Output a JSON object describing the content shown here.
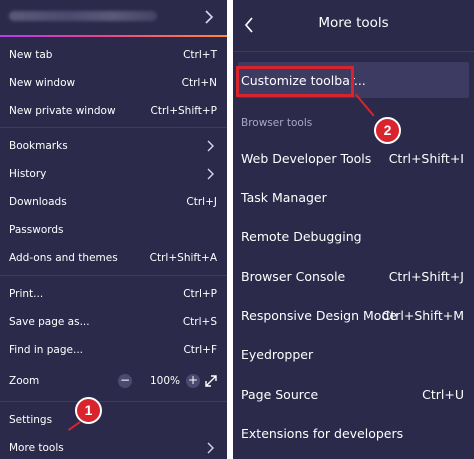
{
  "left_menu": {
    "items": [
      {
        "label": "New tab",
        "shortcut": "Ctrl+T"
      },
      {
        "label": "New window",
        "shortcut": "Ctrl+N"
      },
      {
        "label": "New private window",
        "shortcut": "Ctrl+Shift+P"
      },
      {
        "label": "Bookmarks",
        "shortcut": ""
      },
      {
        "label": "History",
        "shortcut": ""
      },
      {
        "label": "Downloads",
        "shortcut": "Ctrl+J"
      },
      {
        "label": "Passwords",
        "shortcut": ""
      },
      {
        "label": "Add-ons and themes",
        "shortcut": "Ctrl+Shift+A"
      },
      {
        "label": "Print...",
        "shortcut": "Ctrl+P"
      },
      {
        "label": "Save page as...",
        "shortcut": "Ctrl+S"
      },
      {
        "label": "Find in page...",
        "shortcut": "Ctrl+F"
      },
      {
        "label": "Zoom",
        "shortcut": ""
      },
      {
        "label": "Settings",
        "shortcut": ""
      },
      {
        "label": "More tools",
        "shortcut": ""
      }
    ],
    "zoom": {
      "minus": "−",
      "value": "100%",
      "plus": "+"
    }
  },
  "right_menu": {
    "title": "More tools",
    "customize_label": "Customize toolbar...",
    "section_label": "Browser tools",
    "items": [
      {
        "label": "Web Developer Tools",
        "shortcut": "Ctrl+Shift+I"
      },
      {
        "label": "Task Manager",
        "shortcut": ""
      },
      {
        "label": "Remote Debugging",
        "shortcut": ""
      },
      {
        "label": "Browser Console",
        "shortcut": "Ctrl+Shift+J"
      },
      {
        "label": "Responsive Design Mode",
        "shortcut": "Ctrl+Shift+M"
      },
      {
        "label": "Eyedropper",
        "shortcut": ""
      },
      {
        "label": "Page Source",
        "shortcut": "Ctrl+U"
      },
      {
        "label": "Extensions for developers",
        "shortcut": ""
      }
    ]
  },
  "annotations": {
    "step1": "1",
    "step2": "2"
  },
  "colors": {
    "panel_bg": "#2b2a4a",
    "highlight_bg": "#3e3b63",
    "annotation_red": "#d9232d",
    "text": "#ffffff"
  }
}
